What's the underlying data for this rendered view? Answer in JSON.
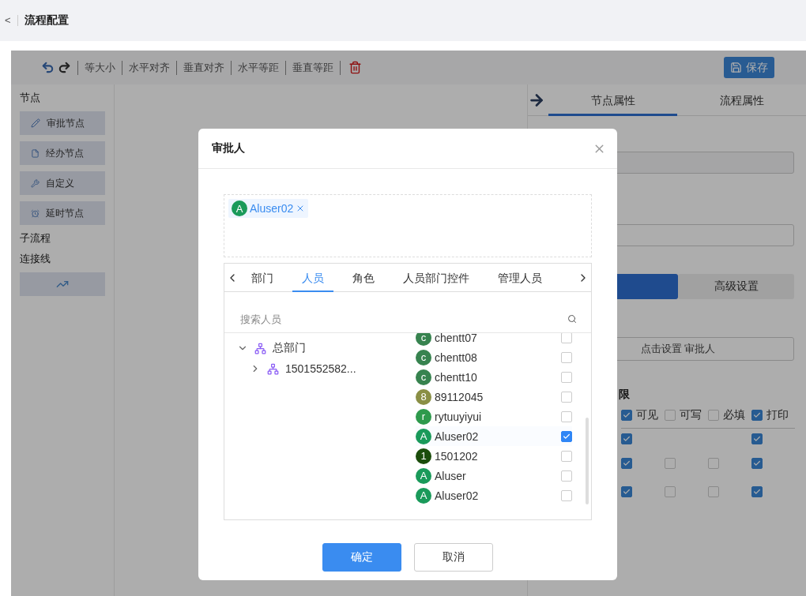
{
  "header": {
    "back": "<",
    "title": "流程配置"
  },
  "toolbar": {
    "buttons": [
      "等大小",
      "水平对齐",
      "垂直对齐",
      "水平等距",
      "垂直等距"
    ],
    "save": "保存"
  },
  "sidebar": {
    "sections": [
      {
        "title": "节点",
        "items": [
          {
            "kind": "pencil",
            "label": "审批节点"
          },
          {
            "kind": "file",
            "label": "经办节点"
          },
          {
            "kind": "tools",
            "label": "自定义"
          },
          {
            "kind": "clock",
            "label": "延时节点"
          }
        ]
      },
      {
        "title": "子流程"
      },
      {
        "title": "连接线",
        "items": [
          {
            "kind": "line"
          }
        ]
      }
    ]
  },
  "properties": {
    "tabs": [
      {
        "label": "节点属性",
        "selected": true
      },
      {
        "label": "流程属性",
        "selected": false
      }
    ],
    "segments": [
      {
        "selected": true
      },
      {
        "label": "高级设置",
        "selected": false
      }
    ],
    "approver_field": "点击设置 审批人",
    "permission_heading": "限",
    "permission_header": [
      {
        "label": "可见",
        "checked": true
      },
      {
        "label": "可写",
        "checked": false
      },
      {
        "label": "必填",
        "checked": false
      },
      {
        "label": "打印",
        "checked": true
      }
    ],
    "permission_rows": [
      [
        true,
        null,
        null,
        true
      ],
      [
        true,
        false,
        false,
        true
      ],
      [
        true,
        false,
        false,
        true
      ]
    ]
  },
  "dialog": {
    "title": "审批人",
    "selected": [
      {
        "initial": "A",
        "name": "Aluser02",
        "color": "#1a9a5a"
      }
    ],
    "tabs": [
      {
        "label": "部门",
        "selected": false
      },
      {
        "label": "人员",
        "selected": true
      },
      {
        "label": "角色",
        "selected": false
      },
      {
        "label": "人员部门控件",
        "selected": false
      },
      {
        "label": "管理人员",
        "selected": false
      }
    ],
    "search": {
      "placeholder": "搜索人员"
    },
    "tree": [
      {
        "label": "总部门",
        "expanded": true,
        "children": [
          {
            "label": "1501552582...",
            "expanded": false
          }
        ]
      }
    ],
    "people": [
      {
        "initial": "c",
        "name": "chentt07",
        "color": "#37834f",
        "checked": false
      },
      {
        "initial": "c",
        "name": "chentt08",
        "color": "#37834f",
        "checked": false
      },
      {
        "initial": "c",
        "name": "chentt10",
        "color": "#37834f",
        "checked": false
      },
      {
        "initial": "8",
        "name": "89112045",
        "color": "#8a8f45",
        "checked": false
      },
      {
        "initial": "r",
        "name": "rytuuyiyui",
        "color": "#2e9a4c",
        "checked": false
      },
      {
        "initial": "A",
        "name": "Aluser02",
        "color": "#1a9a5a",
        "checked": true
      },
      {
        "initial": "1",
        "name": "1501202",
        "color": "#1b4d0b",
        "checked": false
      },
      {
        "initial": "A",
        "name": "Aluser",
        "color": "#1a9a5a",
        "checked": false
      },
      {
        "initial": "A",
        "name": "Aluser02",
        "color": "#1a9a5a",
        "checked": false
      }
    ],
    "buttons": [
      {
        "label": "确定",
        "kind": "primary"
      },
      {
        "label": "取消",
        "kind": "default"
      }
    ]
  }
}
